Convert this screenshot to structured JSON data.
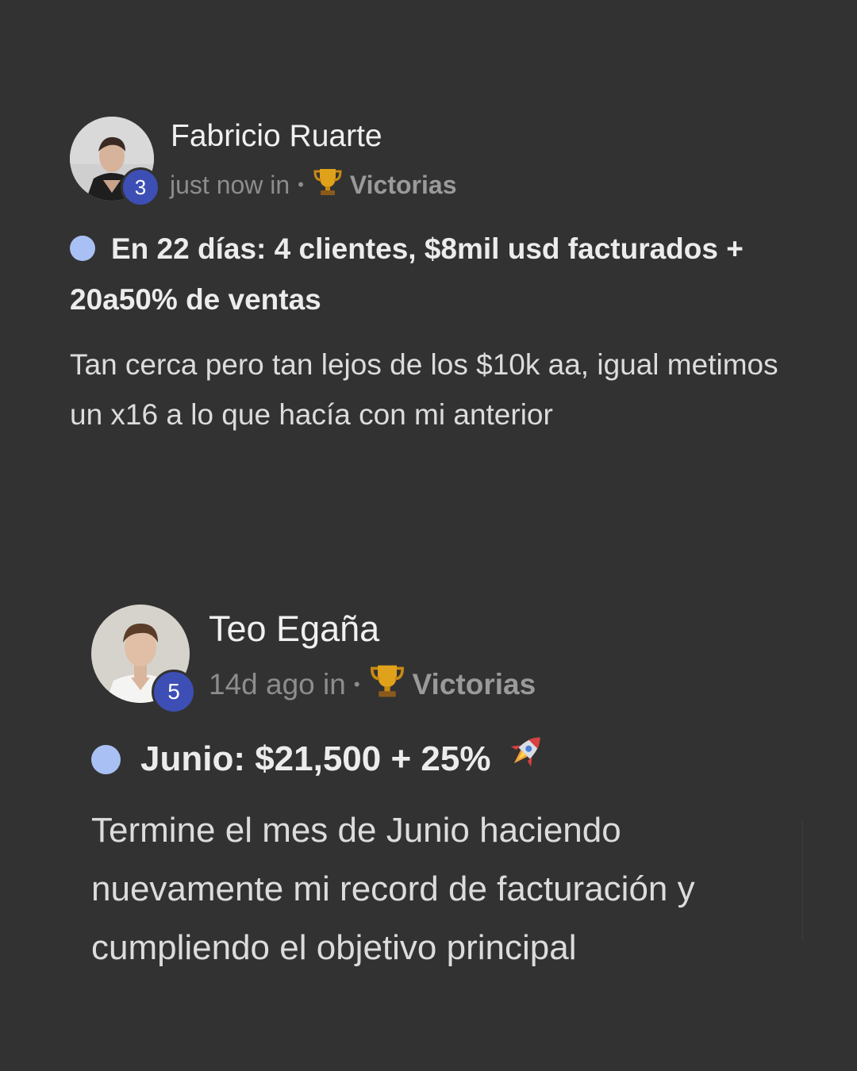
{
  "posts": [
    {
      "author": "Fabricio Ruarte",
      "level": "3",
      "time": "just now in",
      "separator": "•",
      "category_icon": "trophy-icon",
      "category": "Victorias",
      "title": "En 22 días: 4 clientes, $8mil usd facturados + 20a50% de ventas",
      "body": "Tan cerca pero tan lejos de los $10k aa, igual metimos un x16 a lo que hacía con mi anterior"
    },
    {
      "author": "Teo Egaña",
      "level": "5",
      "time": "14d ago in",
      "separator": "•",
      "category_icon": "trophy-icon",
      "category": "Victorias",
      "title": "Junio: $21,500 + 25%",
      "title_icon": "rocket-icon",
      "body": "Termine el mes de Junio haciendo nuevamente mi record de facturación y cumpliendo el objetivo principal"
    }
  ],
  "colors": {
    "background": "#323232",
    "badge": "#3d4fb5",
    "bullet": "#a9c0f5",
    "muted": "#8d8d8d"
  }
}
